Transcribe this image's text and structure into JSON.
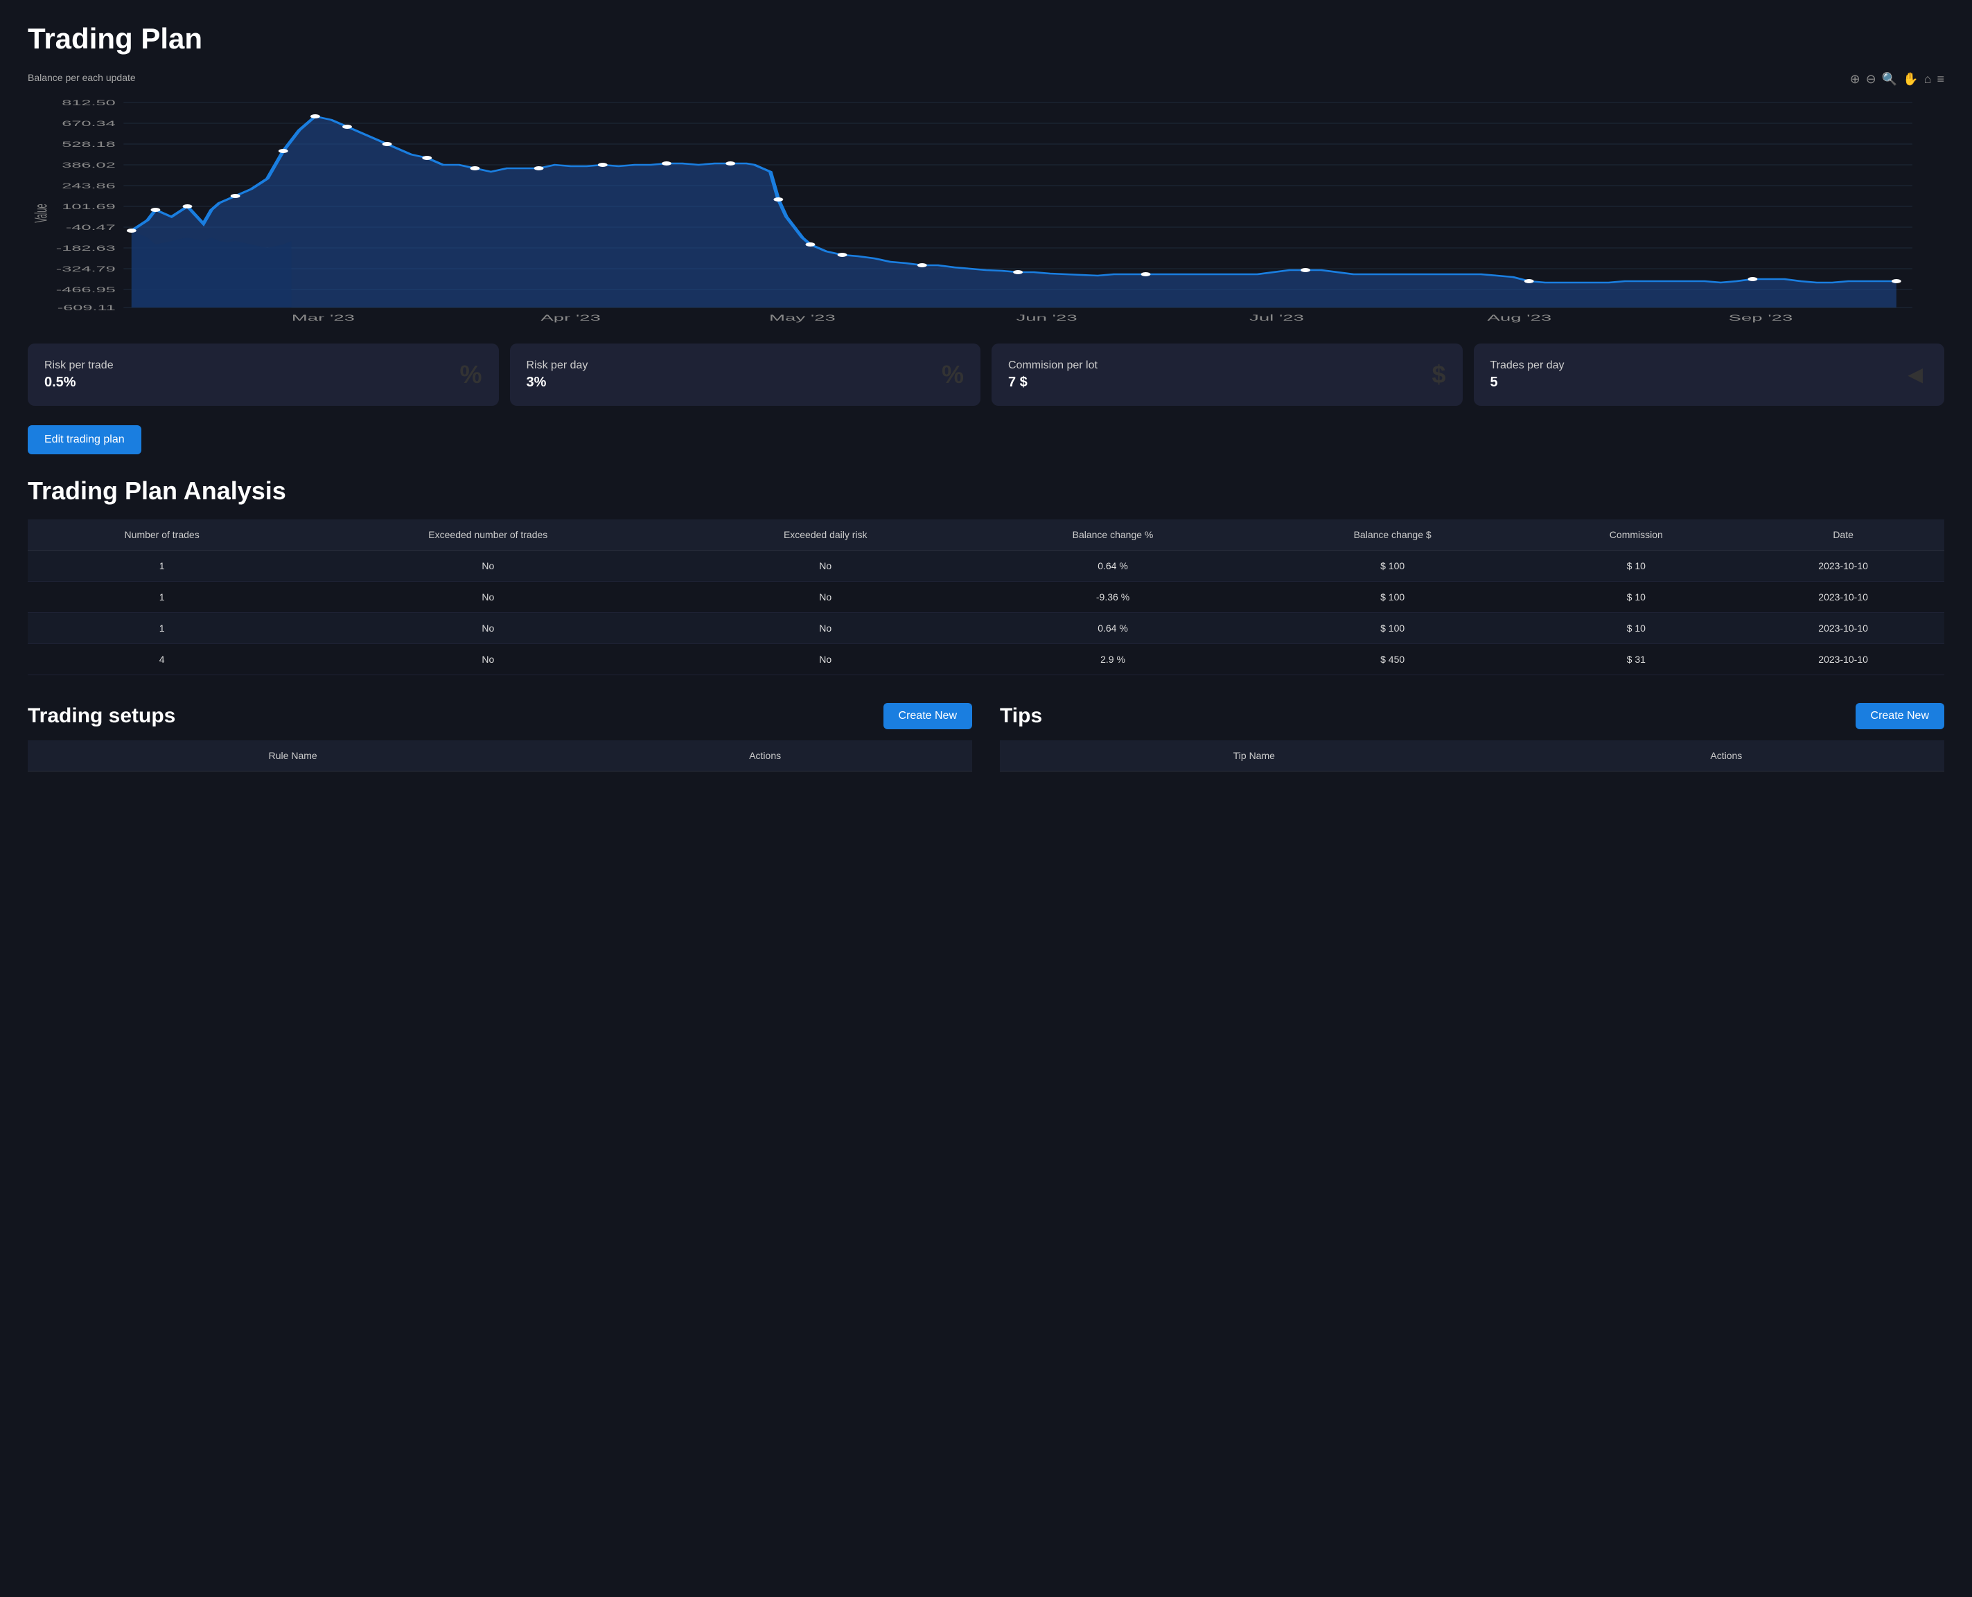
{
  "page": {
    "title": "Trading Plan"
  },
  "chart": {
    "label": "Balance per each update",
    "y_labels": [
      "812.50",
      "670.34",
      "528.18",
      "386.02",
      "243.86",
      "101.69",
      "-40.47",
      "-182.63",
      "-324.79",
      "-466.95",
      "-609.11"
    ],
    "x_labels": [
      "Mar '23",
      "Apr '23",
      "May '23",
      "Jun '23",
      "Jul '23",
      "Aug '23",
      "Sep '23"
    ],
    "toolbar_icons": [
      {
        "name": "zoom-in-icon",
        "symbol": "⊕"
      },
      {
        "name": "zoom-out-icon",
        "symbol": "⊖"
      },
      {
        "name": "search-icon",
        "symbol": "🔍"
      },
      {
        "name": "pan-icon",
        "symbol": "✋"
      },
      {
        "name": "home-icon",
        "symbol": "⌂"
      },
      {
        "name": "menu-icon",
        "symbol": "≡"
      }
    ]
  },
  "metrics": [
    {
      "title": "Risk per trade",
      "value": "0.5%",
      "icon": "%"
    },
    {
      "title": "Risk per day",
      "value": "3%",
      "icon": "%"
    },
    {
      "title": "Commision per lot",
      "value": "7 $",
      "icon": "$"
    },
    {
      "title": "Trades per day",
      "value": "5",
      "icon": "◄"
    }
  ],
  "edit_button": "Edit trading plan",
  "analysis": {
    "title": "Trading Plan Analysis",
    "columns": [
      "Number of trades",
      "Exceeded number of trades",
      "Exceeded daily risk",
      "Balance change %",
      "Balance change $",
      "Commission",
      "Date"
    ],
    "rows": [
      [
        "1",
        "No",
        "No",
        "0.64 %",
        "$ 100",
        "$ 10",
        "2023-10-10"
      ],
      [
        "1",
        "No",
        "No",
        "-9.36 %",
        "$ 100",
        "$ 10",
        "2023-10-10"
      ],
      [
        "1",
        "No",
        "No",
        "0.64 %",
        "$ 100",
        "$ 10",
        "2023-10-10"
      ],
      [
        "4",
        "No",
        "No",
        "2.9 %",
        "$ 450",
        "$ 31",
        "2023-10-10"
      ]
    ]
  },
  "setups": {
    "title": "Trading setups",
    "create_button": "Create New",
    "columns": [
      "Rule Name",
      "Actions"
    ]
  },
  "tips": {
    "title": "Tips",
    "create_button": "Create New",
    "columns": [
      "Tip Name",
      "Actions"
    ]
  }
}
